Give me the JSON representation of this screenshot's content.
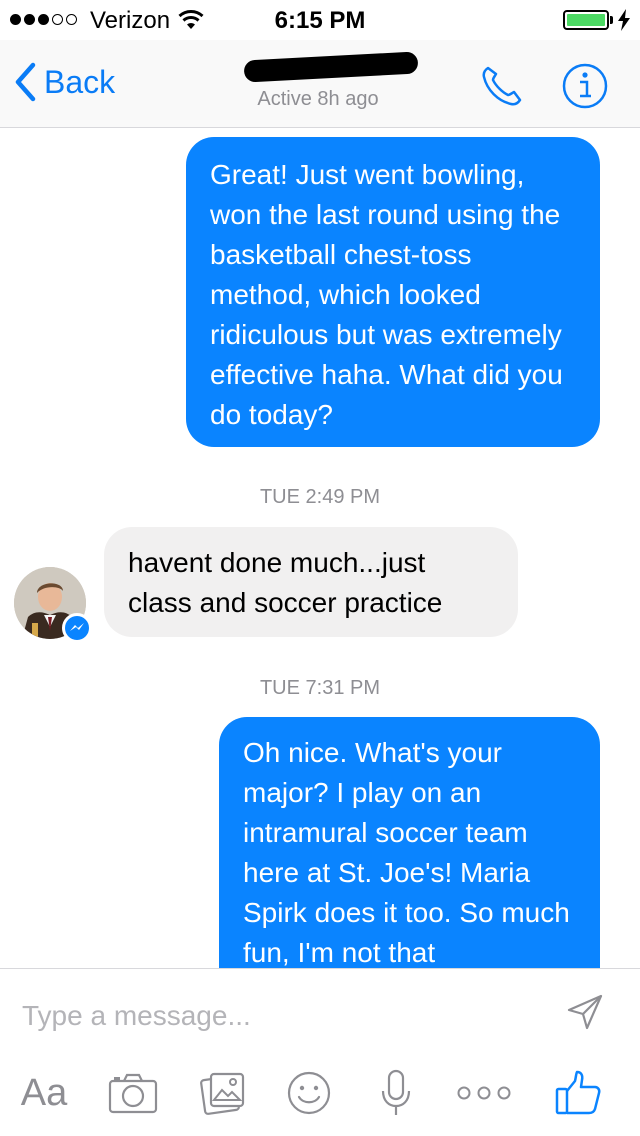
{
  "status_bar": {
    "carrier": "Verizon",
    "time": "6:15 PM",
    "signal_bars_filled": 3,
    "signal_bars_total": 5,
    "battery_level": 1.0,
    "icons": [
      "signal-dots-icon",
      "wifi-icon",
      "battery-icon",
      "charging-bolt-icon"
    ]
  },
  "nav": {
    "back_label": "Back",
    "active_status": "Active 8h ago",
    "icons": [
      "chevron-left-icon",
      "phone-icon",
      "info-icon"
    ]
  },
  "messages": [
    {
      "direction": "outgoing",
      "text": "Great! Just went bowling, won the last round using the basketball chest-toss method, which looked ridiculous but was extremely effective haha. What did you do today?"
    },
    {
      "type": "timestamp",
      "text": "TUE 2:49 PM"
    },
    {
      "direction": "incoming",
      "text": "havent done much...just class and soccer practice"
    },
    {
      "type": "timestamp",
      "text": "TUE 7:31 PM"
    },
    {
      "direction": "outgoing",
      "text": "Oh nice. What's your major? I play on an intramural soccer team here at St. Joe's! Maria Spirk does it too. So much fun, I'm not that"
    }
  ],
  "composer": {
    "placeholder": "Type a message...",
    "value": "",
    "aa_label": "Aa",
    "tools": [
      "text-format-icon",
      "camera-icon",
      "photo-icon",
      "emoji-icon",
      "microphone-icon",
      "more-icon",
      "like-icon"
    ]
  },
  "colors": {
    "accent": "#0a84ff",
    "nav_accent": "#0a7cf6",
    "incoming_bubble": "#f1f0f0",
    "secondary_text": "#8e8e93",
    "battery": "#4cd964"
  }
}
